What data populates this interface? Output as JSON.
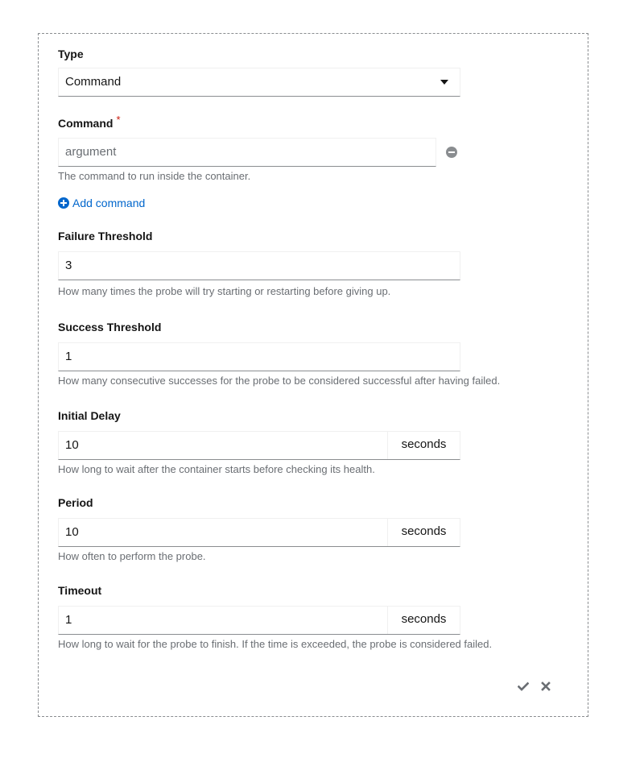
{
  "type_field": {
    "label": "Type",
    "selected": "Command"
  },
  "command_field": {
    "label": "Command",
    "required_marker": "*",
    "placeholder": "argument",
    "value": "",
    "helper": "The command to run inside the container.",
    "add_label": "Add command"
  },
  "failure_threshold": {
    "label": "Failure Threshold",
    "value": "3",
    "helper": "How many times the probe will try starting or restarting before giving up."
  },
  "success_threshold": {
    "label": "Success Threshold",
    "value": "1",
    "helper": "How many consecutive successes for the probe to be considered successful after having failed."
  },
  "initial_delay": {
    "label": "Initial Delay",
    "value": "10",
    "unit": "seconds",
    "helper": "How long to wait after the container starts before checking its health."
  },
  "period": {
    "label": "Period",
    "value": "10",
    "unit": "seconds",
    "helper": "How often to perform the probe."
  },
  "timeout": {
    "label": "Timeout",
    "value": "1",
    "unit": "seconds",
    "helper": "How long to wait for the probe to finish. If the time is exceeded, the probe is considered failed."
  },
  "actions": {
    "confirm": "check-icon",
    "cancel": "close-icon"
  }
}
